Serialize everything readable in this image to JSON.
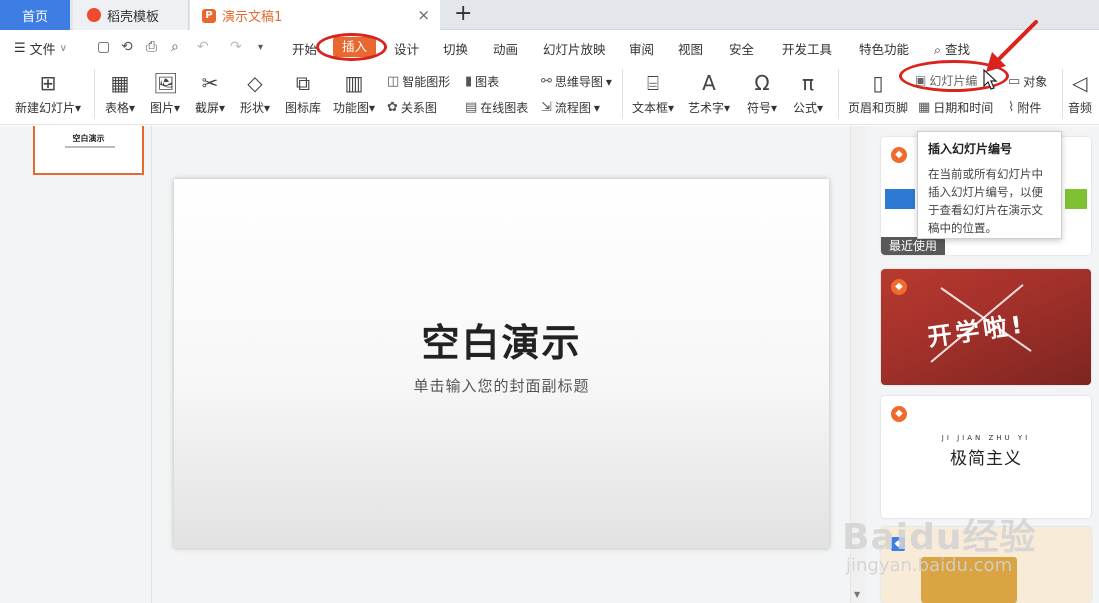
{
  "tabs": {
    "home": "首页",
    "daoke": "稻壳模板",
    "doc": "演示文稿1",
    "close_glyph": "×",
    "add_glyph": "+"
  },
  "menu": {
    "file": "文件",
    "items": [
      "开始",
      "插入",
      "设计",
      "切换",
      "动画",
      "幻灯片放映",
      "审阅",
      "视图",
      "安全",
      "开发工具",
      "特色功能"
    ],
    "search": "查找"
  },
  "ribbon": {
    "new_slide": "新建幻灯片",
    "table": "表格",
    "image": "图片",
    "screenshot": "截屏",
    "shape": "形状",
    "icon_lib": "图标库",
    "func_chart": "功能图",
    "smart_shape": "智能图形",
    "chart": "图表",
    "mind_map": "思维导图",
    "relation": "关系图",
    "online_chart": "在线图表",
    "flowchart": "流程图",
    "textbox": "文本框",
    "wordart": "艺术字",
    "symbol": "符号",
    "formula": "公式",
    "header_footer": "页眉和页脚",
    "slide_number": "幻灯片编",
    "object": "对象",
    "date_time": "日期和时间",
    "attachment": "附件",
    "audio": "音频"
  },
  "thumbnail": {
    "title": "空白演示"
  },
  "slide": {
    "title": "空白演示",
    "subtitle": "单击输入您的封面副标题"
  },
  "right_panel": {
    "recent_label": "最近使用",
    "card2_text": "开学啦!",
    "card3_pinyin": "JI JIAN ZHU YI",
    "card3_title": "极简主义"
  },
  "tooltip": {
    "title": "插入幻灯片编号",
    "description": "在当前或所有幻灯片中插入幻灯片编号，以便于查看幻灯片在演示文稿中的位置。"
  },
  "watermark": {
    "baidu": "Baidu经验",
    "url": "jingyan.baidu.com"
  },
  "colors": {
    "accent": "#e8682f",
    "tab_blue": "#3d7de4",
    "annotation_red": "#d9231d"
  }
}
